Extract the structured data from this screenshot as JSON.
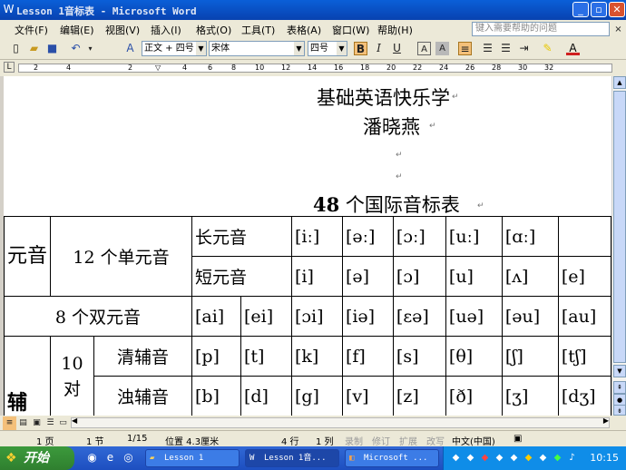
{
  "window": {
    "title": "Lesson 1音标表 - Microsoft Word"
  },
  "menu": [
    "文件(F)",
    "编辑(E)",
    "视图(V)",
    "插入(I)",
    "格式(O)",
    "工具(T)",
    "表格(A)",
    "窗口(W)",
    "帮助(H)"
  ],
  "help_placeholder": "键入需要帮助的问题",
  "toolbar": {
    "style": "正文 + 四号",
    "font": "宋体",
    "size": "四号",
    "bold": "B",
    "italic": "I",
    "underline": "U",
    "charA": "A"
  },
  "ruler": {
    "numbers": [
      "2",
      "4",
      "2",
      "4",
      "6",
      "8",
      "10",
      "12",
      "14",
      "16",
      "18",
      "20",
      "22",
      "24",
      "26",
      "28",
      "30",
      "32"
    ]
  },
  "doc": {
    "line1": "基础英语快乐学",
    "line2": "潘晓燕",
    "heading_num": "48",
    "heading_text": " 个国际音标表"
  },
  "table": {
    "yuanyin": "元音",
    "danyuanyin": "12 个单元音",
    "chang": "长元音",
    "duan": "短元音",
    "long_vowels": [
      "[iː]",
      "[əː]",
      "[ɔː]",
      "[uː]",
      "[ɑː]"
    ],
    "short_vowels": [
      "[i]",
      "[ə]",
      "[ɔ]",
      "[u]",
      "[ʌ]",
      "[e]"
    ],
    "shuangyuanyin": "8 个双元音",
    "diphthongs": [
      "[ai]",
      "[ei]",
      "[ɔi]",
      "[iə]",
      "[εə]",
      "[uə]",
      "[əu]",
      "[au]"
    ],
    "fu": "辅",
    "shidui": "10 对",
    "qing": "清辅音",
    "zhuo": "浊辅音",
    "voiceless": [
      "[p]",
      "[t]",
      "[k]",
      "[f]",
      "[s]",
      "[θ]",
      "[ʃ]",
      "[tʃ]"
    ],
    "voiced": [
      "[b]",
      "[d]",
      "[g]",
      "[v]",
      "[z]",
      "[ð]",
      "[ʒ]",
      "[dʒ]"
    ]
  },
  "status": {
    "page": "1 页",
    "section": "1 节",
    "pages": "1/15",
    "position": "位置 4.3厘米",
    "line": "4 行",
    "col": "1 列",
    "rec": "录制",
    "trk": "修订",
    "ext": "扩展",
    "ovr": "改写",
    "lang": "中文(中国)"
  },
  "taskbar": {
    "start": "开始",
    "tasks": [
      "Lesson 1",
      "Lesson 1音...",
      "Microsoft ..."
    ],
    "clock": "10:15"
  }
}
